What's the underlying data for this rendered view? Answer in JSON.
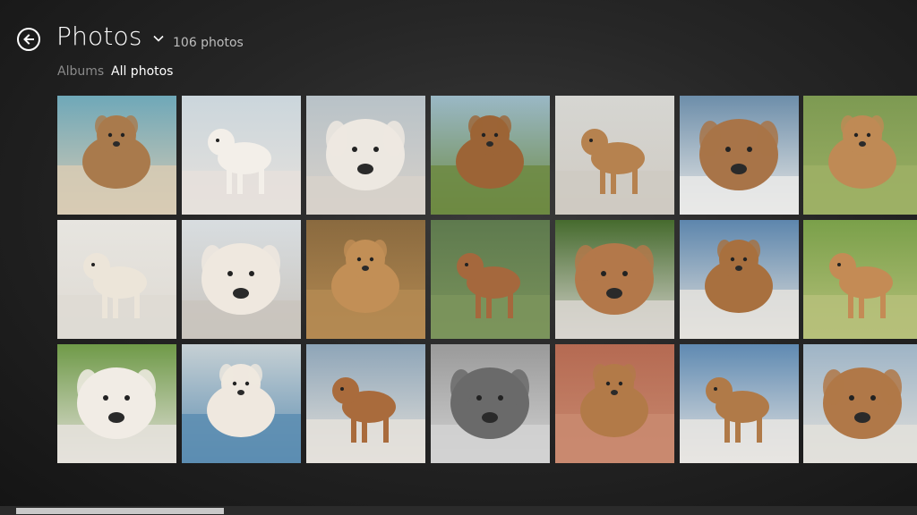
{
  "header": {
    "title": "Photos",
    "photo_count": "106 photos"
  },
  "nav": {
    "albums_label": "Albums",
    "all_photos_label": "All photos"
  },
  "icons": {
    "back": "back-arrow-icon",
    "dropdown": "chevron-down-icon"
  },
  "photos": [
    {
      "subject": "puppy on beach",
      "bg": "#6fa8b8",
      "ground": "#d8cbb4",
      "dog": "#a97a4c"
    },
    {
      "subject": "white bulldog puppy",
      "bg": "#cbd6dc",
      "ground": "#e6e1dc",
      "dog": "#f3efe9"
    },
    {
      "subject": "white bulldog close-up",
      "bg": "#b8c2c8",
      "ground": "#d7d1ca",
      "dog": "#ede8e1"
    },
    {
      "subject": "brown puppy on grass",
      "bg": "#9ab8c6",
      "ground": "#6d8a42",
      "dog": "#9c6436"
    },
    {
      "subject": "puppy at white gate",
      "bg": "#d6d6d2",
      "ground": "#cfcac2",
      "dog": "#b6824f"
    },
    {
      "subject": "puppy on leash blue door",
      "bg": "#6d8eaa",
      "ground": "#e9e9e7",
      "dog": "#a87448"
    },
    {
      "subject": "puppy portrait grass",
      "bg": "#7d9a52",
      "ground": "#9db065",
      "dog": "#bf8a55"
    },
    {
      "subject": "white bulldog sitting",
      "bg": "#e7e5e0",
      "ground": "#dedad3",
      "dog": "#ece5d9"
    },
    {
      "subject": "bulldog with hand",
      "bg": "#d8dde0",
      "ground": "#c9c4bd",
      "dog": "#efe8df"
    },
    {
      "subject": "puppy face close-up",
      "bg": "#8a6a3f",
      "ground": "#b48a52",
      "dog": "#c28f56"
    },
    {
      "subject": "puppy face on grass",
      "bg": "#5e7a4e",
      "ground": "#7b945c",
      "dog": "#a5683d"
    },
    {
      "subject": "puppy sniffing grass",
      "bg": "#466b2e",
      "ground": "#d8d5cf",
      "dog": "#b3784a"
    },
    {
      "subject": "puppy sitting blue door",
      "bg": "#5d86ad",
      "ground": "#e4e2dd",
      "dog": "#a8703f"
    },
    {
      "subject": "puppy face green bg",
      "bg": "#7aa04a",
      "ground": "#b6c07a",
      "dog": "#c48b55"
    },
    {
      "subject": "bulldog lying grass",
      "bg": "#6f9a48",
      "ground": "#e5e2dc",
      "dog": "#f1ece5"
    },
    {
      "subject": "brown white bulldog",
      "bg": "#c6d0d4",
      "ground": "#5c8db1",
      "dog": "#efe8df"
    },
    {
      "subject": "puppy standing by door",
      "bg": "#8ea5b8",
      "ground": "#e4e1db",
      "dog": "#a96b3c"
    },
    {
      "subject": "sleeping dog black and white",
      "bg": "#9a9a9a",
      "ground": "#d2d2d2",
      "dog": "#6a6a6a"
    },
    {
      "subject": "puppy on brick patio",
      "bg": "#b56a52",
      "ground": "#c98a70",
      "dog": "#b27a48"
    },
    {
      "subject": "puppy sitting blue wall",
      "bg": "#5f8ab2",
      "ground": "#e7e5e2",
      "dog": "#b07a48"
    },
    {
      "subject": "puppy standing on step",
      "bg": "#9eb4c6",
      "ground": "#e2e0db",
      "dog": "#b07848"
    }
  ]
}
